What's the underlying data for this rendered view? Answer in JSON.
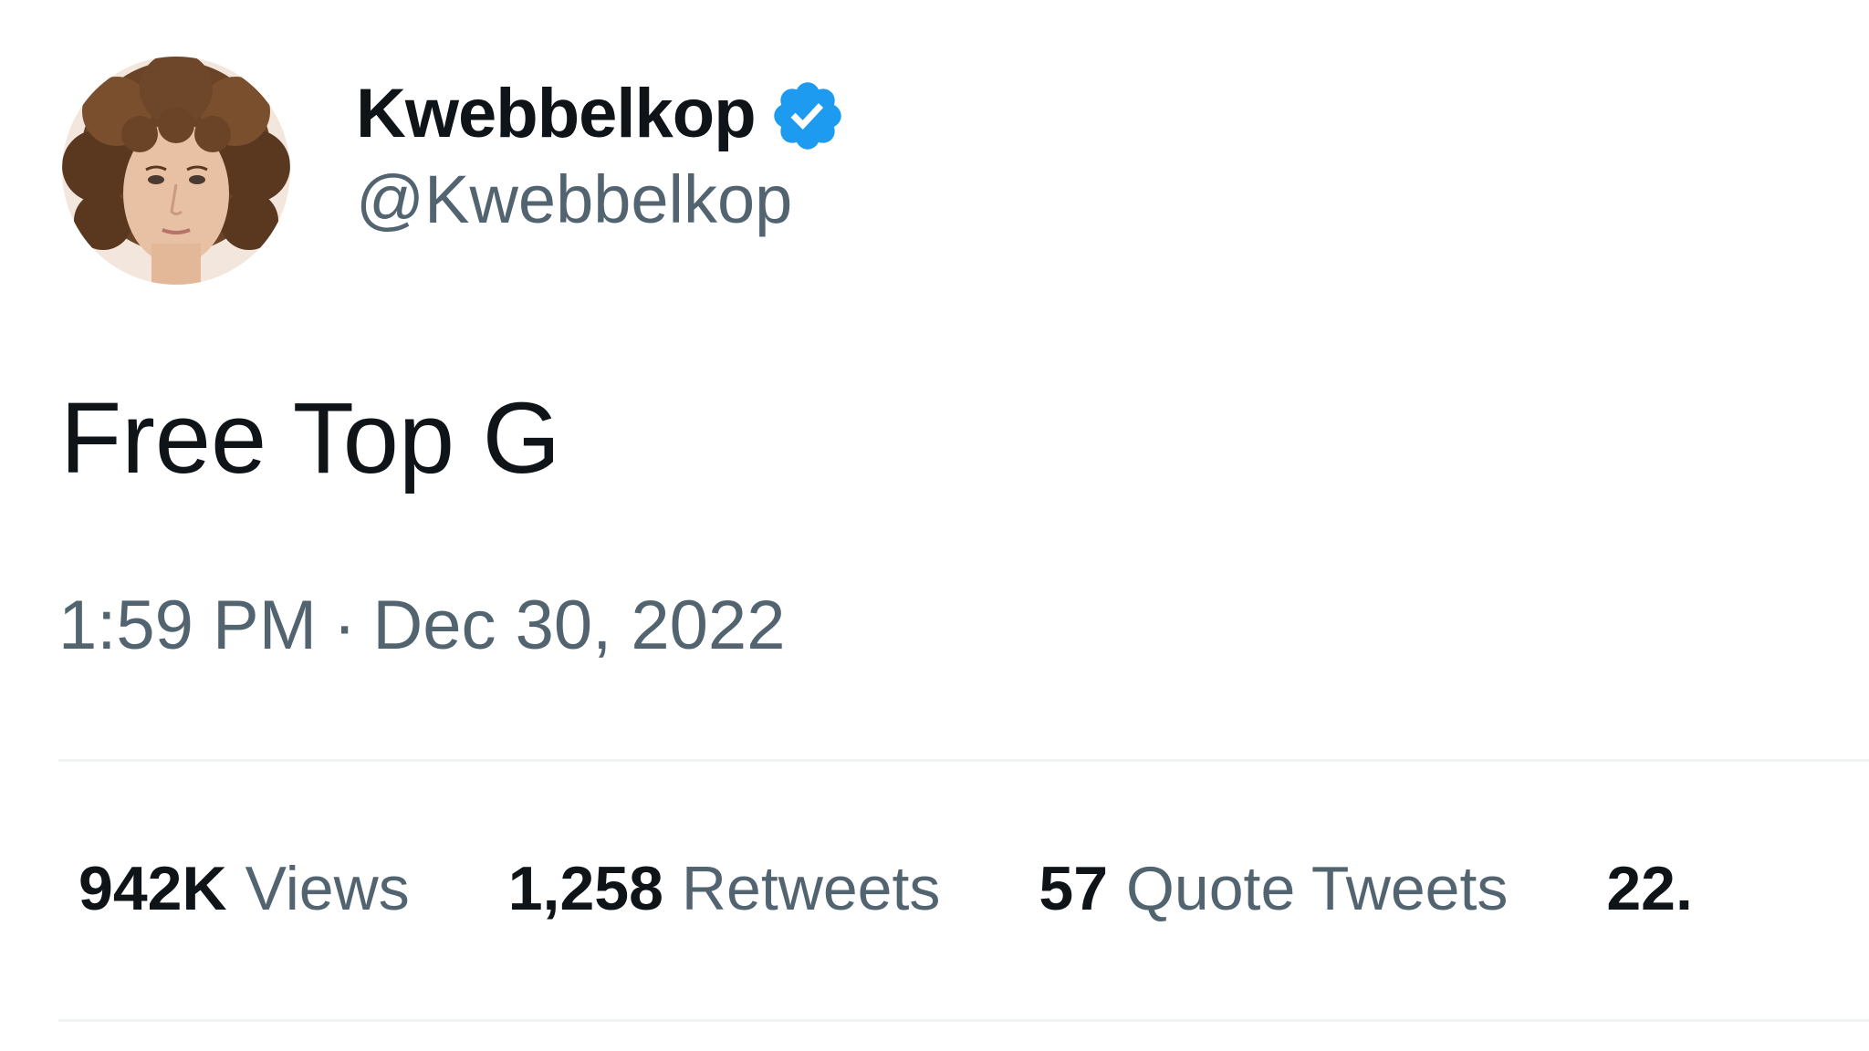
{
  "author": {
    "display_name": "Kwebbelkop",
    "handle": "@Kwebbelkop",
    "avatar_icon": "avatar-photo",
    "verified_icon": "verified-badge-icon",
    "verified_color": "#1d9bf0"
  },
  "tweet": {
    "text": "Free Top G",
    "time": "1:59 PM",
    "separator": "·",
    "date": "Dec 30, 2022"
  },
  "stats": [
    {
      "value": "942K",
      "label": "Views"
    },
    {
      "value": "1,258",
      "label": "Retweets"
    },
    {
      "value": "57",
      "label": "Quote Tweets"
    },
    {
      "value": "22.",
      "label": ""
    }
  ],
  "colors": {
    "primary_text": "#0f1419",
    "secondary_text": "#536471",
    "divider": "#eff3f4"
  }
}
